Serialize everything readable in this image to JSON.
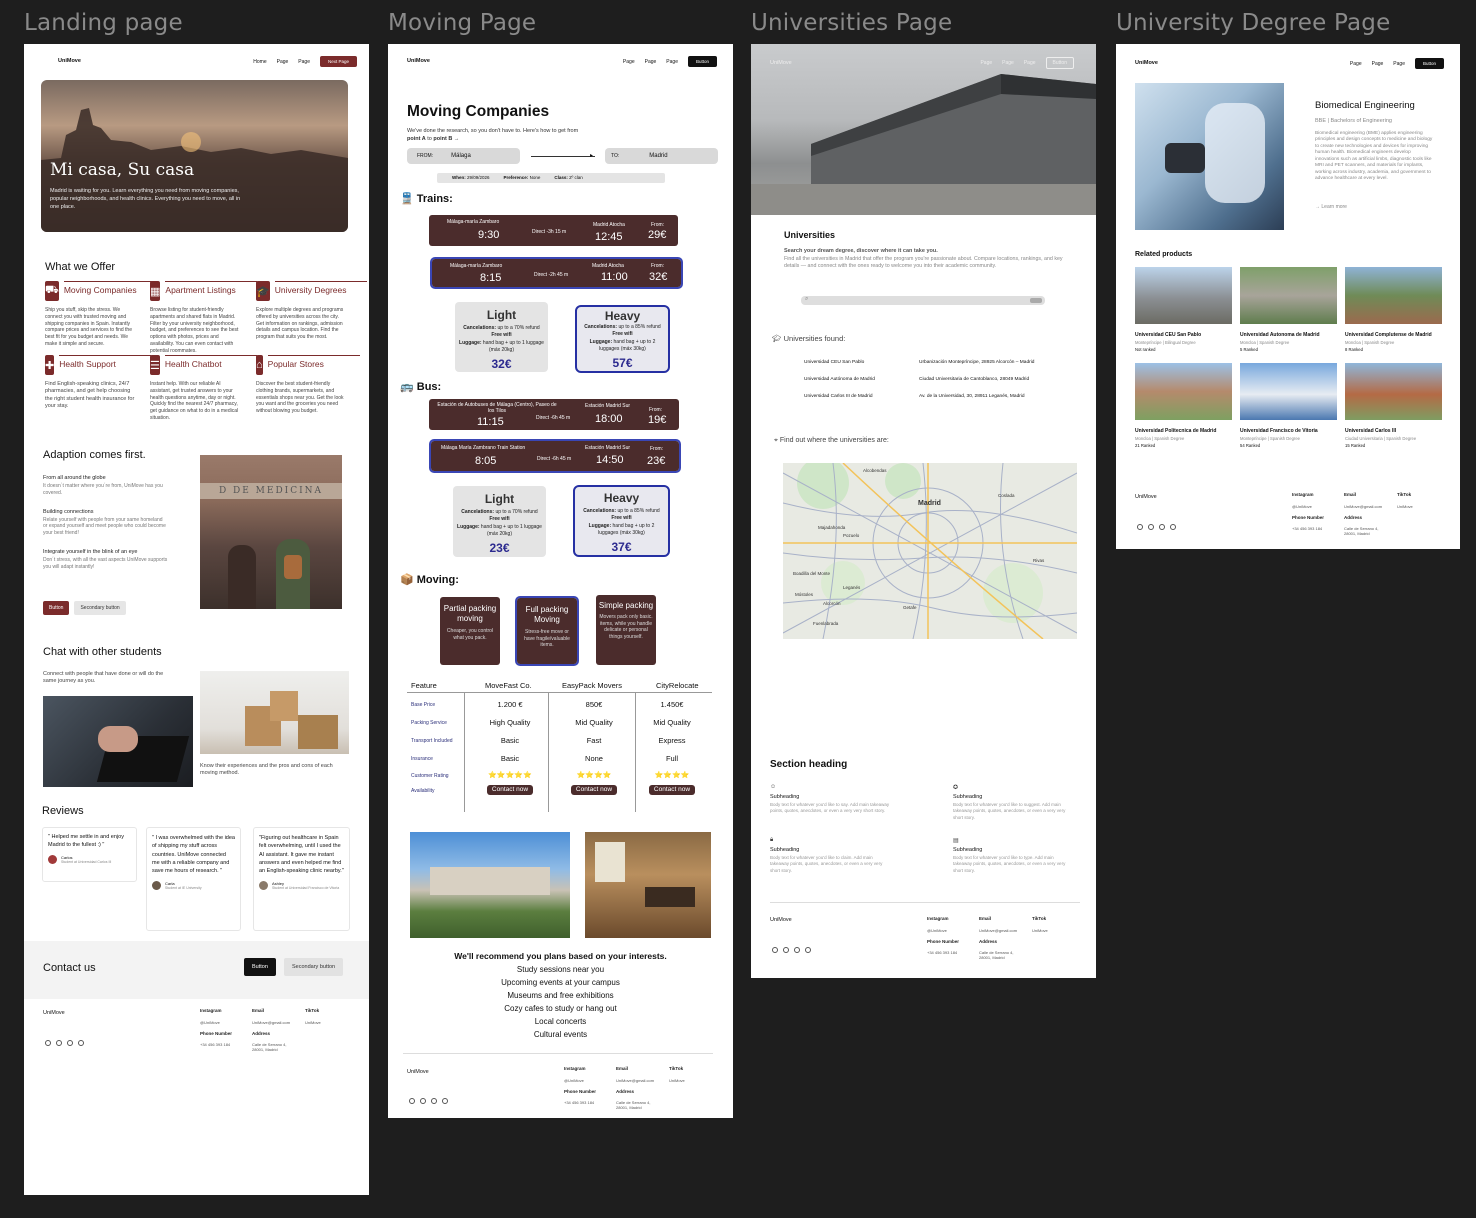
{
  "frames": {
    "landing": "Landing page",
    "moving": "Moving Page",
    "universities": "Universities Page",
    "degree": "University Degree Page"
  },
  "brand": "UniMove",
  "landing": {
    "nav": {
      "home": "Home",
      "page1": "Page",
      "page2": "Page",
      "cta": "Next Page"
    },
    "hero": {
      "title": "Mi casa, Su casa",
      "text": "Madrid is waiting for you. Learn everything you need from moving companies, popular neighborhoods, and health clinics. Everything you need to move, all in one place."
    },
    "offer_title": "What we Offer",
    "offers": [
      {
        "icon": "truck-icon",
        "title": "Moving Companies",
        "text": "Ship you stuff, skip the stress. We connect you with trusted moving and shipping companies in Spain. Instantly compare prices and services to find the best fit for you budget and needs. We make it simple and secure."
      },
      {
        "icon": "building-icon",
        "title": "Apartment Listings",
        "text": "Browse listing for student-friendly apartments and shared flats in Madrid. Filter by your university neighborhood, budget, and preferences to see the best options with photos, prices and availability. You can even contact with potential roommates."
      },
      {
        "icon": "graduation-cap-icon",
        "title": "University Degrees",
        "text": "Explore multiple degrees and programs offered by universities across the city. Get information on rankings, admission details and campus location. Find the program that suits you the most."
      },
      {
        "icon": "health-icon",
        "title": "Health Support",
        "text": "Find English-speaking clinics, 24/7 pharmacies, and get help choosing the right student health insurance for your stay."
      },
      {
        "icon": "chat-icon",
        "title": "Health Chatbot",
        "text": "Instant help. With our reliable AI assistant, get trusted answers to your health questions anytime, day or night. Quickly find the nearest 24/7 pharmacy, get guidance on what to do in a medical situation."
      },
      {
        "icon": "store-icon",
        "title": "Popular Stores",
        "text": "Discover the best student-friendly clothing brands, supermarkets, and essentials shops near you. Get the look you want and the groceries you need without blowing you budget."
      }
    ],
    "adaption": {
      "title": "Adaption comes first.",
      "items": [
        {
          "h": "From all around the globe",
          "t": "It doesn´t matter where you´re from, UniMove has you covered."
        },
        {
          "h": "Building connections",
          "t": "Relate yourself with people from your same homeland or expand yourself and meet people who could become your best friend!"
        },
        {
          "h": "Integrate yourself in the blink of an eye",
          "t": "Don´t stress, with all the vast aspects UniMove supports you will adapt instantly!"
        }
      ],
      "button": "Button",
      "secondary": "Secondary button",
      "sign": "D DE MEDICINA"
    },
    "chat": {
      "title": "Chat with other students",
      "text": "Connect with people that have done or will do the same journey as you.",
      "caption": "Know their experiences and the pros and cons of each moving method."
    },
    "reviews_title": "Reviews",
    "reviews": [
      {
        "quote": "\" Helped me settle in and enjoy Madrid to the fullest :) \"",
        "name": "Carlos",
        "role": "Student at Universidad Carlos III"
      },
      {
        "quote": "\" I was overwhelmed with the idea of shipping my stuff across countries. UniMove connected me with a reliable company and save me hours of research. \"",
        "name": "Carla",
        "role": "Student at IE University"
      },
      {
        "quote": "\"Figuring out healthcare in Spain felt overwhelming, until I used the AI assistant. It gave me instant answers and even helped me find an English-speaking clinic nearby.\"",
        "name": "Ashley",
        "role": "Student at Universidad Francisco de Vitoria"
      }
    ],
    "contact": {
      "title": "Contact us",
      "button": "Button",
      "secondary": "Secondary button"
    }
  },
  "footer": {
    "instagram_h": "Instagram",
    "instagram": "@UniMove",
    "email_h": "Email",
    "email": "UniMove@gmail.com",
    "tiktok_h": "TikTok",
    "tiktok": "UniMove",
    "phone_h": "Phone Number",
    "phone": "+34 456 393 184",
    "address_h": "Address",
    "address": "Calle de Serrano 4, 28001, Madrid"
  },
  "moving": {
    "nav": {
      "p1": "Page",
      "p2": "Page",
      "p3": "Page",
      "cta": "Button"
    },
    "title": "Moving Companies",
    "subtitle": "We've done the research, so you don't have to. Here's how to get from",
    "point_a": "point A",
    "to": "to",
    "point_b": "point B →",
    "from_label": "FROM:",
    "from_value": "Málaga",
    "to_label": "TO:",
    "to_value": "Madrid",
    "when_label": "When:",
    "when": "29/09/2026",
    "pref_label": "Preference:",
    "pref": "None",
    "class_label": "Class:",
    "class": "2º clan",
    "trains_title": "🚆 Trains:",
    "trains": [
      {
        "from": "Málaga-maría Zambaro",
        "dep": "9:30",
        "dur": "Direct -3h 15 m",
        "to": "Madrid Atocha",
        "arr": "12:45",
        "price_label": "From:",
        "price": "29€"
      },
      {
        "from": "Málaga-maría Zambaro",
        "dep": "8:15",
        "dur": "Direct -2h 45 m",
        "to": "Madrid Atocha",
        "arr": "11:00",
        "price_label": "From:",
        "price": "32€"
      }
    ],
    "train_fares": [
      {
        "title": "Light",
        "canc_l": "Cancelations:",
        "canc": "up to a 70% refund",
        "wifi": "Free wifi",
        "lug_l": "Luggage:",
        "lug": "hand bag + up to 1 luggage (máx 20kg)",
        "price": "32€"
      },
      {
        "title": "Heavy",
        "canc_l": "Cancelations:",
        "canc": "up to a 85% refund",
        "wifi": "Free wifi",
        "lug_l": "Luggage:",
        "lug": "hand bag + up to 2 luggages (máx 30kg)",
        "price": "57€"
      }
    ],
    "bus_title": "🚌 Bus:",
    "buses": [
      {
        "from": "Estación de Autobuses de Málaga (Centro), Paseo de los Tilos",
        "dep": "11:15",
        "dur": "Direct -6h 45 m",
        "to": "Estación Madrid Sur",
        "arr": "18:00",
        "price_label": "From:",
        "price": "19€"
      },
      {
        "from": "Málaga María Zambrano Train Station",
        "dep": "8:05",
        "dur": "Direct -6h 45 m",
        "to": "Estación Madrid Sur",
        "arr": "14:50",
        "price_label": "From:",
        "price": "23€"
      }
    ],
    "bus_fares": [
      {
        "title": "Light",
        "canc_l": "Cancelations:",
        "canc": "up to a 70% refund",
        "wifi": "Free wifi",
        "lug_l": "Luggage:",
        "lug": "hand bag + up to 1 luggage (máx 20kg)",
        "price": "23€"
      },
      {
        "title": "Heavy",
        "canc_l": "Cancelations:",
        "canc": "up to a 85% refund",
        "wifi": "Free wifi",
        "lug_l": "Luggage:",
        "lug": "hand bag + up to 2 luggages (máx 30kg)",
        "price": "37€"
      }
    ],
    "moving_title": "📦 Moving:",
    "moving_opts": [
      {
        "title": "Partial packing moving",
        "text": "Cheaper, you control what you pack."
      },
      {
        "title": "Full packing Moving",
        "text": "Stress-free move or have fragile/valuable items."
      },
      {
        "title": "Simple packing",
        "text": "Movers pack only basic. items, while you handle delicate or personal things yourself."
      }
    ],
    "table": {
      "headers": [
        "Feature",
        "MoveFast Co.",
        "EasyPack Movers",
        "CityRelocate"
      ],
      "rows": [
        [
          "Base Price",
          "1.200 €",
          "850€",
          "1.450€"
        ],
        [
          "Packing Service",
          "High Quality",
          "Mid Quality",
          "Mid Quality"
        ],
        [
          "Transport Included",
          "Basic",
          "Fast",
          "Express"
        ],
        [
          "Insurance",
          "Basic",
          "None",
          "Full"
        ],
        [
          "Customer Rating",
          "⭐⭐⭐⭐⭐",
          "⭐⭐⭐⭐",
          "⭐⭐⭐⭐"
        ],
        [
          "Availability",
          "Contact now",
          "Contact now",
          "Contact now"
        ]
      ]
    },
    "recommend_title": "We'll recommend you plans based on your interests.",
    "recommend": [
      "Study sessions near you",
      "Upcoming events at your campus",
      "Museums and free exhibitions",
      "Cozy cafes to study or hang out",
      "Local concerts",
      "Cultural events"
    ]
  },
  "universities": {
    "nav": {
      "p1": "Page",
      "p2": "Page",
      "p3": "Page",
      "cta": "Button"
    },
    "title": "Universities",
    "subtitle": "Search your dream degree, discover where it can take you.",
    "text": "Find all the universities in Madrid that offer the program you're passionate about. Compare locations, rankings, and key details — and connect with the ones ready to welcome you into their academic community.",
    "found": "Universities found:",
    "list": [
      {
        "name": "Universidad CEU San Pablo",
        "addr": "Urbanización Montepríncipe, 28925 Alcorcón – Madrid"
      },
      {
        "name": "Universidad Autónoma de Madrid",
        "addr": "Ciudad Universitaria de Cantoblanco, 28049 Madrid"
      },
      {
        "name": "Universidad Carlos III de Madrid",
        "addr": "Av. de la Universidad, 30, 28911 Leganés, Madrid"
      }
    ],
    "map_title": "Find out where the universities are:",
    "map_labels": [
      "Madrid",
      "Alcobendas",
      "Majadahonda",
      "Boadilla del Monte",
      "Pozuelo",
      "Coslada",
      "Leganés",
      "Getafe",
      "Fuenlabrada",
      "Rivas",
      "Alcorcón",
      "Móstoles"
    ],
    "section_heading": "Section heading",
    "features": [
      {
        "icon": "smile-icon",
        "h": "Subheading",
        "t": "Body text for whatever you'd like to say. Add main takeaway points, quotes, anecdotes, or even a very very short story."
      },
      {
        "icon": "award-icon",
        "h": "Subheading",
        "t": "Body text for whatever you'd like to suggest. Add main takeaway points, quotes, anecdotes, or even a very very short story."
      },
      {
        "icon": "lock-icon",
        "h": "Subheading",
        "t": "Body text for whatever you'd like to claim. Add main takeaway points, quotes, anecdotes, or even a very very short story."
      },
      {
        "icon": "calendar-icon",
        "h": "Subheading",
        "t": "Body text for whatever you'd like to type. Add main takeaway points, quotes, anecdotes, or even a very very short story."
      }
    ]
  },
  "degree": {
    "nav": {
      "p1": "Page",
      "p2": "Page",
      "p3": "Page",
      "cta": "Button"
    },
    "title": "Biomedical Engineering",
    "sub": "BBE | Bachelors of Engineering",
    "text": "Biomedical engineering (BME) applies engineering principles and design concepts to medicine and biology to create new technologies and devices for improving human health. Biomedical engineers develop innovations such as artificial limbs, diagnostic tools like MRI and PET scanners, and materials for implants, working across industry, academia, and government to advance healthcare at every level.",
    "learn": "→  Learn more",
    "related": "Related products",
    "products": [
      {
        "name": "Universidad CEU San Pablo",
        "sub": "Montepríncipe | Bilingual Degree",
        "rank": "Not ranked"
      },
      {
        "name": "Universidad Autonoma de Madrid",
        "sub": "Moncloa | Spanish Degree",
        "rank": "5 Ranked"
      },
      {
        "name": "Universidad Complutense de Madrid",
        "sub": "Moncloa | Spanish Degree",
        "rank": "8 Ranked"
      },
      {
        "name": "Universidad Politecnica de Madrid",
        "sub": "Moncloa | Spanish Degree",
        "rank": "21 Ranked"
      },
      {
        "name": "Universidad Francisco de Vitoria",
        "sub": "Montepríncipe | Spanish Degree",
        "rank": "54 Ranked"
      },
      {
        "name": "Universidad Carlos III",
        "sub": "Ciudad Universitaria | Spanish Degree",
        "rank": "15 Ranked"
      }
    ]
  }
}
